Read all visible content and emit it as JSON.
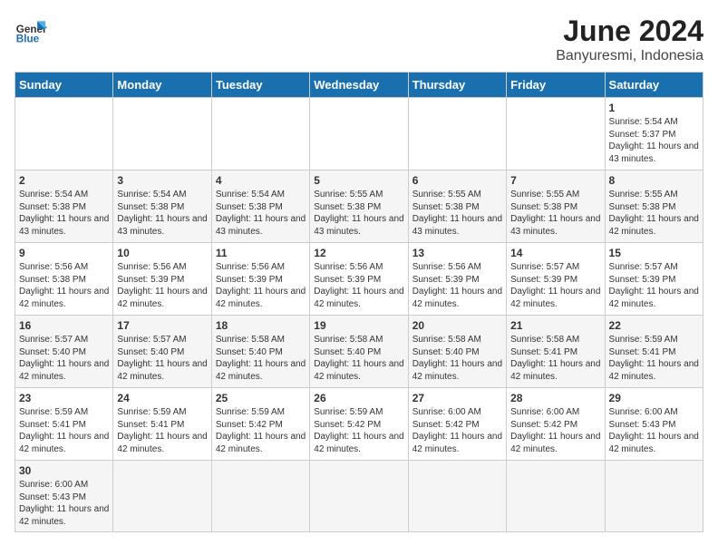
{
  "header": {
    "logo_general": "General",
    "logo_blue": "Blue",
    "title": "June 2024",
    "subtitle": "Banyuresmi, Indonesia"
  },
  "days": [
    "Sunday",
    "Monday",
    "Tuesday",
    "Wednesday",
    "Thursday",
    "Friday",
    "Saturday"
  ],
  "cells": [
    [
      {
        "num": "",
        "info": ""
      },
      {
        "num": "",
        "info": ""
      },
      {
        "num": "",
        "info": ""
      },
      {
        "num": "",
        "info": ""
      },
      {
        "num": "",
        "info": ""
      },
      {
        "num": "",
        "info": ""
      },
      {
        "num": "1",
        "info": "Sunrise: 5:54 AM\nSunset: 5:37 PM\nDaylight: 11 hours\nand 43 minutes."
      }
    ],
    [
      {
        "num": "2",
        "info": "Sunrise: 5:54 AM\nSunset: 5:38 PM\nDaylight: 11 hours\nand 43 minutes."
      },
      {
        "num": "3",
        "info": "Sunrise: 5:54 AM\nSunset: 5:38 PM\nDaylight: 11 hours\nand 43 minutes."
      },
      {
        "num": "4",
        "info": "Sunrise: 5:54 AM\nSunset: 5:38 PM\nDaylight: 11 hours\nand 43 minutes."
      },
      {
        "num": "5",
        "info": "Sunrise: 5:55 AM\nSunset: 5:38 PM\nDaylight: 11 hours\nand 43 minutes."
      },
      {
        "num": "6",
        "info": "Sunrise: 5:55 AM\nSunset: 5:38 PM\nDaylight: 11 hours\nand 43 minutes."
      },
      {
        "num": "7",
        "info": "Sunrise: 5:55 AM\nSunset: 5:38 PM\nDaylight: 11 hours\nand 43 minutes."
      },
      {
        "num": "8",
        "info": "Sunrise: 5:55 AM\nSunset: 5:38 PM\nDaylight: 11 hours\nand 42 minutes."
      }
    ],
    [
      {
        "num": "9",
        "info": "Sunrise: 5:56 AM\nSunset: 5:38 PM\nDaylight: 11 hours\nand 42 minutes."
      },
      {
        "num": "10",
        "info": "Sunrise: 5:56 AM\nSunset: 5:39 PM\nDaylight: 11 hours\nand 42 minutes."
      },
      {
        "num": "11",
        "info": "Sunrise: 5:56 AM\nSunset: 5:39 PM\nDaylight: 11 hours\nand 42 minutes."
      },
      {
        "num": "12",
        "info": "Sunrise: 5:56 AM\nSunset: 5:39 PM\nDaylight: 11 hours\nand 42 minutes."
      },
      {
        "num": "13",
        "info": "Sunrise: 5:56 AM\nSunset: 5:39 PM\nDaylight: 11 hours\nand 42 minutes."
      },
      {
        "num": "14",
        "info": "Sunrise: 5:57 AM\nSunset: 5:39 PM\nDaylight: 11 hours\nand 42 minutes."
      },
      {
        "num": "15",
        "info": "Sunrise: 5:57 AM\nSunset: 5:39 PM\nDaylight: 11 hours\nand 42 minutes."
      }
    ],
    [
      {
        "num": "16",
        "info": "Sunrise: 5:57 AM\nSunset: 5:40 PM\nDaylight: 11 hours\nand 42 minutes."
      },
      {
        "num": "17",
        "info": "Sunrise: 5:57 AM\nSunset: 5:40 PM\nDaylight: 11 hours\nand 42 minutes."
      },
      {
        "num": "18",
        "info": "Sunrise: 5:58 AM\nSunset: 5:40 PM\nDaylight: 11 hours\nand 42 minutes."
      },
      {
        "num": "19",
        "info": "Sunrise: 5:58 AM\nSunset: 5:40 PM\nDaylight: 11 hours\nand 42 minutes."
      },
      {
        "num": "20",
        "info": "Sunrise: 5:58 AM\nSunset: 5:40 PM\nDaylight: 11 hours\nand 42 minutes."
      },
      {
        "num": "21",
        "info": "Sunrise: 5:58 AM\nSunset: 5:41 PM\nDaylight: 11 hours\nand 42 minutes."
      },
      {
        "num": "22",
        "info": "Sunrise: 5:59 AM\nSunset: 5:41 PM\nDaylight: 11 hours\nand 42 minutes."
      }
    ],
    [
      {
        "num": "23",
        "info": "Sunrise: 5:59 AM\nSunset: 5:41 PM\nDaylight: 11 hours\nand 42 minutes."
      },
      {
        "num": "24",
        "info": "Sunrise: 5:59 AM\nSunset: 5:41 PM\nDaylight: 11 hours\nand 42 minutes."
      },
      {
        "num": "25",
        "info": "Sunrise: 5:59 AM\nSunset: 5:42 PM\nDaylight: 11 hours\nand 42 minutes."
      },
      {
        "num": "26",
        "info": "Sunrise: 5:59 AM\nSunset: 5:42 PM\nDaylight: 11 hours\nand 42 minutes."
      },
      {
        "num": "27",
        "info": "Sunrise: 6:00 AM\nSunset: 5:42 PM\nDaylight: 11 hours\nand 42 minutes."
      },
      {
        "num": "28",
        "info": "Sunrise: 6:00 AM\nSunset: 5:42 PM\nDaylight: 11 hours\nand 42 minutes."
      },
      {
        "num": "29",
        "info": "Sunrise: 6:00 AM\nSunset: 5:43 PM\nDaylight: 11 hours\nand 42 minutes."
      }
    ],
    [
      {
        "num": "30",
        "info": "Sunrise: 6:00 AM\nSunset: 5:43 PM\nDaylight: 11 hours\nand 42 minutes."
      },
      {
        "num": "",
        "info": ""
      },
      {
        "num": "",
        "info": ""
      },
      {
        "num": "",
        "info": ""
      },
      {
        "num": "",
        "info": ""
      },
      {
        "num": "",
        "info": ""
      },
      {
        "num": "",
        "info": ""
      }
    ]
  ]
}
